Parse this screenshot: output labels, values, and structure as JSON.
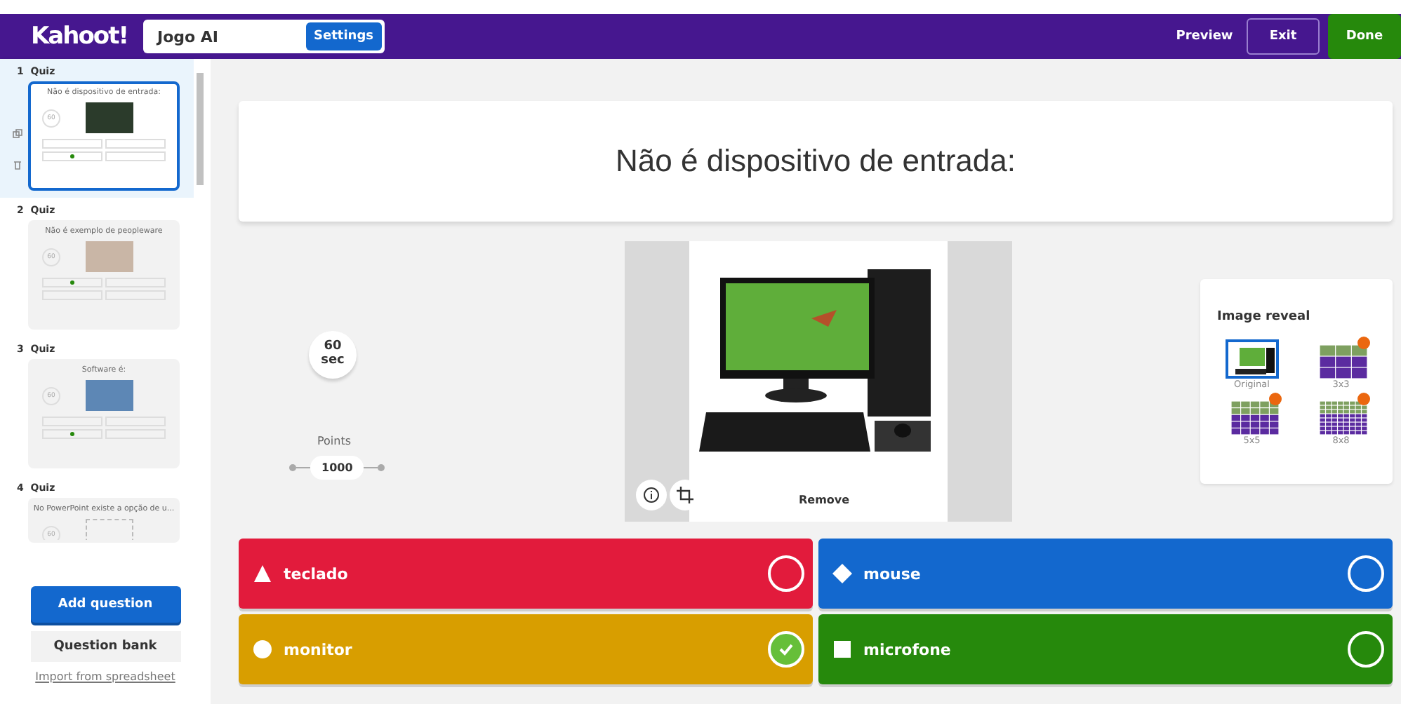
{
  "header": {
    "logo": "Kahoot!",
    "title_value": "Jogo AI",
    "settings": "Settings",
    "preview": "Preview",
    "exit": "Exit",
    "done": "Done"
  },
  "slides": [
    {
      "number": "1",
      "type": "Quiz",
      "title": "Não é dispositivo de entrada:",
      "time": "60",
      "selected": true,
      "answers": [
        {
          "correct": false
        },
        {
          "correct": false
        },
        {
          "correct": true
        },
        {
          "correct": false
        }
      ]
    },
    {
      "number": "2",
      "type": "Quiz",
      "title": "Não é exemplo de peopleware",
      "time": "60",
      "selected": false,
      "answers": [
        {
          "correct": true
        },
        {
          "correct": false
        },
        {
          "correct": false
        },
        {
          "correct": false
        }
      ]
    },
    {
      "number": "3",
      "type": "Quiz",
      "title": "Software é:",
      "time": "60",
      "selected": false,
      "answers": [
        {
          "correct": false
        },
        {
          "correct": false
        },
        {
          "correct": true
        },
        {
          "correct": false
        }
      ]
    },
    {
      "number": "4",
      "type": "Quiz",
      "title": "No PowerPoint existe a opção de u...",
      "time": "60",
      "selected": false
    }
  ],
  "sidebar_buttons": {
    "add": "Add question",
    "bank": "Question bank",
    "import": "Import from spreadsheet"
  },
  "question": "Não é dispositivo de entrada:",
  "timer": {
    "value": "60",
    "unit": "sec"
  },
  "points": {
    "label": "Points",
    "value": "1000"
  },
  "media": {
    "remove": "Remove"
  },
  "image_reveal": {
    "title": "Image reveal",
    "options": [
      {
        "label": "Original",
        "selected": true,
        "premium": false
      },
      {
        "label": "3x3",
        "selected": false,
        "premium": true
      },
      {
        "label": "5x5",
        "selected": false,
        "premium": true
      },
      {
        "label": "8x8",
        "selected": false,
        "premium": true
      }
    ]
  },
  "answers": [
    {
      "text": "teclado",
      "color": "#e21b3c",
      "correct": false
    },
    {
      "text": "mouse",
      "color": "#1368ce",
      "correct": false
    },
    {
      "text": "monitor",
      "color": "#d89e00",
      "correct": true
    },
    {
      "text": "microfone",
      "color": "#26890c",
      "correct": false
    }
  ]
}
